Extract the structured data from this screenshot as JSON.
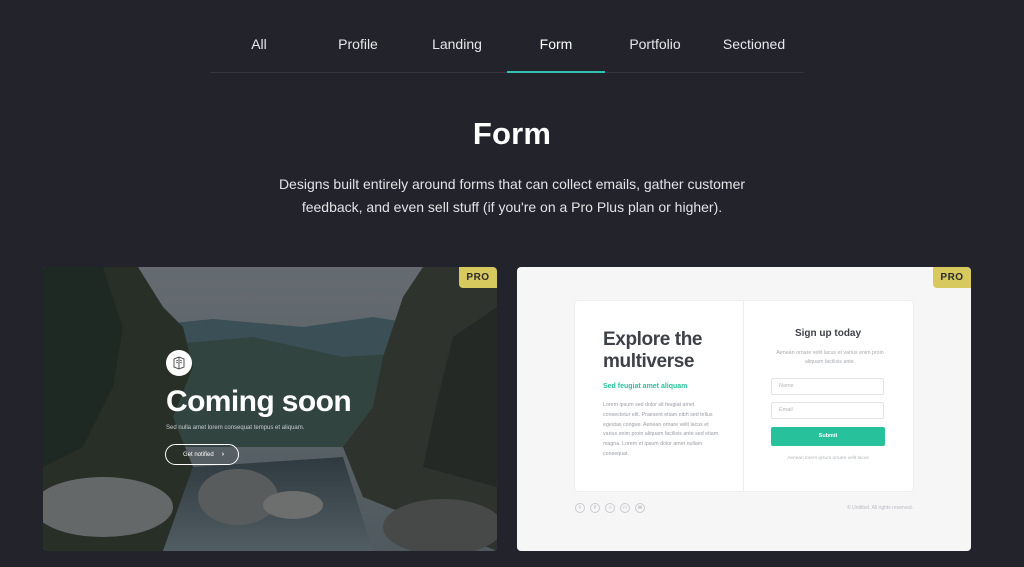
{
  "tabs": [
    "All",
    "Profile",
    "Landing",
    "Form",
    "Portfolio",
    "Sectioned"
  ],
  "active_tab": "Form",
  "heading": "Form",
  "description": "Designs built entirely around forms that can collect emails, gather customer feedback, and even sell stuff (if you're on a Pro Plus plan or higher).",
  "cards": [
    {
      "badge": "PRO",
      "title": "Coming soon",
      "subtitle": "Sed nulla amet lorem consequat tempus et aliquam.",
      "button": "Get notified",
      "button_icon": "chevron-right-icon"
    },
    {
      "badge": "PRO",
      "heading": "Explore the multiverse",
      "tagline": "Sed feugiat amet aliquam",
      "body": "Lorem ipsum sed dolor sit feugiat amet consectetur elit. Praesent etiam nibh sed tellus egestas congue. Aenean ornare velit lacus et varius enim proin aliquam facilisis ante sed etiam magna. Lorem et ipsum dolor amet nullam consequat.",
      "form_title": "Sign up today",
      "form_text": "Aenean ornare velit lacus et varius enim proin aliquam facilisis ante.",
      "name_placeholder": "Name",
      "email_placeholder": "Email",
      "submit": "Submit",
      "terms": "Aenean lorem ipsum ornare velit lacus",
      "copyright": "© Untitled. All rights reserved.",
      "social_icons": [
        "twitter-icon",
        "facebook-icon",
        "github-icon",
        "instagram-icon",
        "email-icon"
      ]
    }
  ],
  "colors": {
    "accent": "#2ec4b0",
    "badge": "#d8c95e",
    "form_green": "#27c19b",
    "background": "#23242b"
  }
}
